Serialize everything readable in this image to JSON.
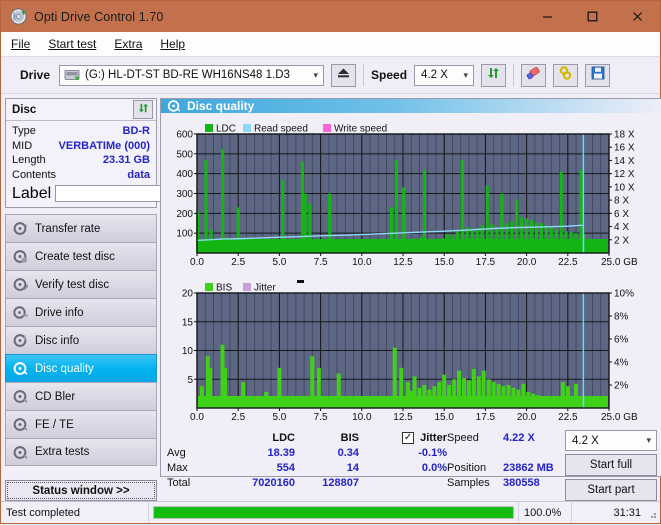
{
  "window": {
    "title": "Opti Drive Control 1.70",
    "icon": "app-disc-icon",
    "minimize": "minimize-icon",
    "maximize": "maximize-icon",
    "close": "close-icon",
    "titlebar_color": "#c3714c"
  },
  "menu": [
    {
      "label": "File",
      "accel": "F"
    },
    {
      "label": "Start test",
      "accel": "S"
    },
    {
      "label": "Extra",
      "accel": "x"
    },
    {
      "label": "Help",
      "accel": "H"
    }
  ],
  "toolbar": {
    "drive_label": "Drive",
    "drive_value": "(G:)  HL-DT-ST BD-RE  WH16NS48 1.D3",
    "eject_icon": "eject-icon",
    "speed_label": "Speed",
    "speed_value": "4.2 X",
    "refresh_icon": "refresh-icon",
    "erase_icon": "eraser-icon",
    "bind_icon": "chain-icon",
    "save_icon": "floppy-save-icon"
  },
  "disc_panel": {
    "title": "Disc",
    "refresh_icon": "refresh-icon",
    "rows": [
      {
        "key": "Type",
        "value": "BD-R"
      },
      {
        "key": "MID",
        "value": "VERBATIMe (000)"
      },
      {
        "key": "Length",
        "value": "23.31 GB"
      },
      {
        "key": "Contents",
        "value": "data"
      }
    ],
    "label_key": "Label",
    "label_value": "",
    "label_placeholder": "",
    "label_button_icon": "disc-icon"
  },
  "nav": {
    "items": [
      {
        "label": "Transfer rate",
        "icon": "disc-transfer-icon",
        "active": false
      },
      {
        "label": "Create test disc",
        "icon": "disc-create-icon",
        "active": false
      },
      {
        "label": "Verify test disc",
        "icon": "disc-verify-icon",
        "active": false
      },
      {
        "label": "Drive info",
        "icon": "disc-drive-icon",
        "active": false
      },
      {
        "label": "Disc info",
        "icon": "disc-info-icon",
        "active": false
      },
      {
        "label": "Disc quality",
        "icon": "disc-quality-icon",
        "active": true
      },
      {
        "label": "CD Bler",
        "icon": "disc-bler-icon",
        "active": false
      },
      {
        "label": "FE / TE",
        "icon": "disc-fete-icon",
        "active": false
      },
      {
        "label": "Extra tests",
        "icon": "disc-extra-icon",
        "active": false
      }
    ],
    "status_window": "Status window >>"
  },
  "main": {
    "header": "Disc quality",
    "header_icon": "disc-quality-icon"
  },
  "stats": {
    "col_ldc": "LDC",
    "col_bis": "BIS",
    "jitter_label": "Jitter",
    "jitter_checked": true,
    "rows": [
      {
        "name": "Avg",
        "ldc": "18.39",
        "bis": "0.34",
        "jitter": "-0.1%"
      },
      {
        "name": "Max",
        "ldc": "554",
        "bis": "14",
        "jitter": "0.0%"
      },
      {
        "name": "Total",
        "ldc": "7020160",
        "bis": "128807",
        "jitter": ""
      }
    ],
    "speed_label": "Speed",
    "speed_value": "4.22 X",
    "position_label": "Position",
    "position_value": "23862 MB",
    "samples_label": "Samples",
    "samples_value": "380558",
    "speed_select": "4.2 X",
    "start_full": "Start full",
    "start_part": "Start part"
  },
  "statusbar": {
    "message": "Test completed",
    "percent_text": "100.0%",
    "percent_value": 100,
    "time": "31:31"
  },
  "colors": {
    "accent": "#00b2ef",
    "ldc_green": "#12b512",
    "bis_green": "#3fd117",
    "read_speed": "#8fd8f5",
    "write_speed": "#ff63d8",
    "jitter": "#c9a0d8",
    "value_blue": "#2424c8",
    "plot_bg": "#5d6784",
    "progress": "#10bd10"
  },
  "chart_data": [
    {
      "type": "area",
      "title": "LDC",
      "xlabel": "GB",
      "ylabel": "LDC",
      "xlim": [
        0,
        25
      ],
      "ylim": [
        0,
        600
      ],
      "xticks": [
        "0.0",
        "2.5",
        "5.0",
        "7.5",
        "10.0",
        "12.5",
        "15.0",
        "17.5",
        "20.0",
        "22.5",
        "25.0 GB"
      ],
      "yticks": [
        100,
        200,
        300,
        400,
        500,
        600
      ],
      "y2ticks": [
        "2 X",
        "4 X",
        "6 X",
        "8 X",
        "10 X",
        "12 X",
        "14 X",
        "16 X",
        "18 X"
      ],
      "y2lim": [
        0,
        18
      ],
      "grid": true,
      "legend": [
        {
          "name": "LDC",
          "color": "#12b512"
        },
        {
          "name": "Read speed",
          "color": "#8fd8f5"
        },
        {
          "name": "Write speed",
          "color": "#ff63d8"
        }
      ],
      "series": [
        {
          "name": "LDC",
          "color": "#12b512",
          "x": [
            0.05,
            0.15,
            0.25,
            0.35,
            0.45,
            0.55,
            0.65,
            0.75,
            0.85,
            0.95,
            1.05,
            1.15,
            1.25,
            1.35,
            1.45,
            1.55,
            1.65,
            1.75,
            1.85,
            1.95,
            2.05,
            2.2,
            2.35,
            2.5,
            2.65,
            2.8,
            2.95,
            3.1,
            3.25,
            3.4,
            3.55,
            3.7,
            3.85,
            4.0,
            4.15,
            4.3,
            4.45,
            4.6,
            4.75,
            4.9,
            5.05,
            5.2,
            5.35,
            5.5,
            5.65,
            5.8,
            5.95,
            6.1,
            6.25,
            6.4,
            6.55,
            6.7,
            6.85,
            7.0,
            7.15,
            7.3,
            7.45,
            7.6,
            7.75,
            7.9,
            8.05,
            8.2,
            8.35,
            8.5,
            8.65,
            8.8,
            8.95,
            9.1,
            9.25,
            9.4,
            9.55,
            9.7,
            9.85,
            10.0,
            10.3,
            10.6,
            10.9,
            11.2,
            11.5,
            11.8,
            12.1,
            12.4,
            12.55,
            12.7,
            12.85,
            13.0,
            13.2,
            13.4,
            13.6,
            13.8,
            14.0,
            14.3,
            14.6,
            14.9,
            15.2,
            15.5,
            15.8,
            16.1,
            16.4,
            16.7,
            17.0,
            17.3,
            17.6,
            17.9,
            18.2,
            18.5,
            18.8,
            19.1,
            19.4,
            19.7,
            20.0,
            20.3,
            20.6,
            20.9,
            21.2,
            21.5,
            21.8,
            22.1,
            22.4,
            22.7,
            23.0,
            23.3,
            23.5
          ],
          "y": [
            210,
            40,
            30,
            25,
            35,
            470,
            60,
            40,
            120,
            30,
            50,
            45,
            30,
            40,
            25,
            525,
            80,
            35,
            30,
            25,
            40,
            30,
            35,
            230,
            30,
            25,
            30,
            40,
            35,
            30,
            25,
            35,
            30,
            40,
            25,
            30,
            35,
            30,
            40,
            35,
            30,
            370,
            40,
            30,
            25,
            35,
            30,
            40,
            35,
            460,
            300,
            40,
            250,
            30,
            35,
            40,
            30,
            25,
            35,
            30,
            300,
            35,
            30,
            40,
            25,
            35,
            30,
            40,
            35,
            30,
            45,
            30,
            35,
            40,
            45,
            50,
            40,
            35,
            45,
            230,
            470,
            60,
            330,
            40,
            50,
            60,
            55,
            70,
            80,
            420,
            60,
            50,
            65,
            75,
            95,
            90,
            110,
            470,
            130,
            115,
            125,
            140,
            340,
            145,
            130,
            300,
            150,
            160,
            270,
            180,
            175,
            165,
            155,
            150,
            140,
            130,
            120,
            410,
            110,
            105,
            100,
            420,
            95
          ]
        },
        {
          "name": "Read speed",
          "color": "#8fd8f5",
          "x": [
            0.0,
            1.5,
            3.0,
            4.5,
            6.0,
            7.5,
            9.0,
            10.5,
            12.0,
            13.5,
            15.0,
            16.5,
            18.0,
            19.5,
            21.0,
            22.5,
            23.4
          ],
          "y": [
            1.9,
            2.1,
            2.2,
            2.35,
            2.45,
            2.6,
            2.7,
            2.85,
            3.0,
            3.15,
            3.3,
            3.5,
            3.7,
            3.85,
            3.95,
            4.05,
            4.2
          ]
        }
      ],
      "cursor_x": 23.45
    },
    {
      "type": "area",
      "title": "BIS",
      "xlabel": "GB",
      "ylabel": "BIS",
      "xlim": [
        0,
        25
      ],
      "ylim": [
        0,
        20
      ],
      "xticks": [
        "0.0",
        "2.5",
        "5.0",
        "7.5",
        "10.0",
        "12.5",
        "15.0",
        "17.5",
        "20.0",
        "22.5",
        "25.0 GB"
      ],
      "yticks": [
        5,
        10,
        15,
        20
      ],
      "y2ticks": [
        "2%",
        "4%",
        "6%",
        "8%",
        "10%"
      ],
      "y2lim": [
        0,
        10
      ],
      "grid": true,
      "legend": [
        {
          "name": "BIS",
          "color": "#3fd117"
        },
        {
          "name": "Jitter",
          "color": "#c9a0d8"
        }
      ],
      "series": [
        {
          "name": "BIS",
          "color": "#3fd117",
          "x": [
            0.1,
            0.3,
            0.5,
            0.65,
            0.8,
            0.95,
            1.1,
            1.25,
            1.4,
            1.55,
            1.7,
            1.85,
            2.0,
            2.2,
            2.4,
            2.6,
            2.8,
            3.0,
            3.2,
            3.4,
            3.6,
            3.8,
            4.0,
            4.2,
            4.4,
            4.6,
            4.8,
            5.0,
            5.2,
            5.4,
            5.6,
            5.8,
            6.0,
            6.2,
            6.4,
            6.6,
            6.8,
            7.0,
            7.2,
            7.4,
            7.6,
            7.8,
            8.0,
            8.2,
            8.4,
            8.6,
            8.8,
            9.0,
            9.2,
            9.4,
            9.6,
            9.8,
            10.0,
            10.4,
            10.8,
            11.2,
            11.6,
            12.0,
            12.4,
            12.8,
            13.0,
            13.2,
            13.5,
            13.8,
            14.1,
            14.4,
            14.7,
            15.0,
            15.3,
            15.6,
            15.9,
            16.2,
            16.5,
            16.8,
            17.1,
            17.4,
            17.7,
            18.0,
            18.3,
            18.6,
            18.9,
            19.2,
            19.5,
            19.8,
            20.1,
            20.4,
            20.7,
            21.0,
            21.3,
            21.6,
            21.9,
            22.2,
            22.5,
            22.8,
            23.0,
            23.2,
            23.4
          ],
          "y": [
            1.2,
            3.8,
            1.5,
            9.0,
            7.0,
            1.3,
            2.0,
            1.4,
            1.1,
            11.0,
            7.0,
            1.5,
            1.2,
            1.3,
            1.0,
            1.1,
            4.5,
            1.2,
            1.1,
            1.3,
            1.0,
            1.2,
            1.1,
            2.8,
            1.2,
            1.0,
            1.3,
            7.0,
            1.4,
            1.1,
            1.2,
            1.0,
            1.3,
            1.2,
            1.1,
            1.4,
            1.2,
            9.0,
            1.3,
            7.0,
            1.2,
            1.1,
            1.3,
            1.5,
            2.0,
            6.0,
            1.4,
            1.3,
            1.2,
            1.5,
            1.3,
            1.4,
            1.6,
            1.5,
            1.7,
            1.6,
            1.8,
            10.5,
            7.0,
            4.5,
            3.0,
            5.5,
            3.5,
            4.0,
            3.2,
            3.8,
            4.5,
            5.8,
            4.0,
            5.0,
            6.5,
            5.2,
            4.8,
            6.8,
            5.5,
            6.5,
            5.0,
            4.5,
            4.2,
            3.8,
            4.0,
            3.5,
            3.2,
            4.2,
            2.8,
            2.5,
            2.2,
            2.0,
            1.8,
            1.6,
            1.5,
            4.5,
            3.8,
            1.4,
            4.2,
            1.3,
            1.0
          ]
        }
      ],
      "cursor_x": 23.45
    }
  ]
}
